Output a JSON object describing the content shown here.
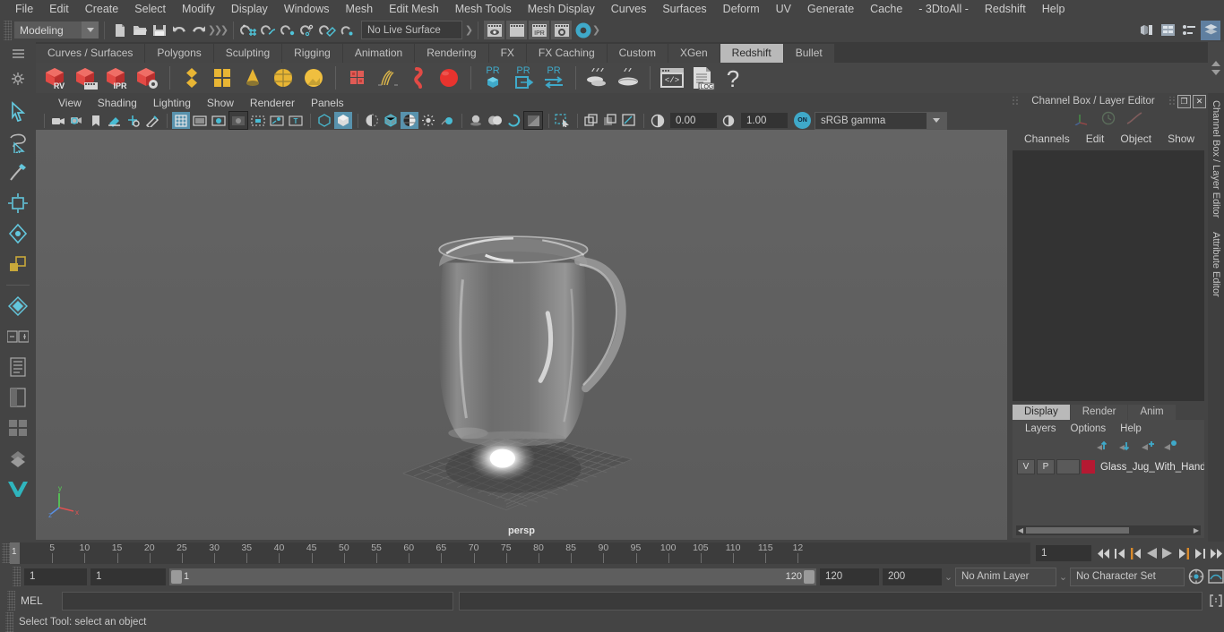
{
  "menubar": {
    "items": [
      "File",
      "Edit",
      "Create",
      "Select",
      "Modify",
      "Display",
      "Windows",
      "Mesh",
      "Edit Mesh",
      "Mesh Tools",
      "Mesh Display",
      "Curves",
      "Surfaces",
      "Deform",
      "UV",
      "Generate",
      "Cache",
      "- 3DtoAll -",
      "Redshift",
      "Help"
    ]
  },
  "statusline": {
    "mode": "Modeling",
    "live_surface": "No Live Surface",
    "render_buttons": [
      "render-view-icon",
      "render-sequence-icon",
      "ipr-icon",
      "render-settings-icon"
    ],
    "file_icons": [
      "new-scene-icon",
      "open-scene-icon",
      "save-scene-icon",
      "undo-icon",
      "redo-icon"
    ],
    "selection_mask_icons": [
      "select-by-hierarchy-icon",
      "select-by-object-icon",
      "select-by-component-icon"
    ],
    "snap_icons": [
      "snap-to-grid-icon",
      "snap-to-curve-icon",
      "snap-to-point-icon",
      "snap-to-projected-center-icon",
      "snap-to-view-plane-icon",
      "make-live-icon"
    ],
    "panel_toggle_icons": [
      "show-hide-modeling-toolkit-icon",
      "show-hide-attribute-editor-icon",
      "show-hide-tool-settings-icon",
      "show-hide-channel-box-icon"
    ]
  },
  "shelf": {
    "tabs": [
      "Curves / Surfaces",
      "Polygons",
      "Sculpting",
      "Rigging",
      "Animation",
      "Rendering",
      "FX",
      "FX Caching",
      "Custom",
      "XGen",
      "Redshift",
      "Bullet"
    ],
    "active_tab": "Redshift",
    "items": [
      {
        "name": "redshift-render-view-icon",
        "label": "RV"
      },
      {
        "name": "redshift-render-sequence-icon",
        "label": ""
      },
      {
        "name": "redshift-ipr-icon",
        "label": "IPR"
      },
      {
        "name": "redshift-render-settings-icon",
        "label": ""
      },
      {
        "name": "redshift-light-area-icon",
        "label": ""
      },
      {
        "name": "redshift-light-dome-icon",
        "label": ""
      },
      {
        "name": "redshift-light-ies-icon",
        "label": ""
      },
      {
        "name": "redshift-light-portal-icon",
        "label": ""
      },
      {
        "name": "redshift-environment-icon",
        "label": ""
      },
      {
        "name": "redshift-proxy-icon",
        "label": ""
      },
      {
        "name": "redshift-hair-icon",
        "label": ""
      },
      {
        "name": "redshift-volume-icon",
        "label": ""
      },
      {
        "name": "redshift-sphere-icon",
        "label": ""
      },
      {
        "name": "redshift-pr-object-icon",
        "label": "PR"
      },
      {
        "name": "redshift-pr-export-icon",
        "label": "PR"
      },
      {
        "name": "redshift-pr-transfer-icon",
        "label": "PR"
      },
      {
        "name": "redshift-bake-icon",
        "label": ""
      },
      {
        "name": "redshift-bake-set-icon",
        "label": ""
      },
      {
        "name": "redshift-script-editor-icon",
        "label": ""
      },
      {
        "name": "redshift-log-icon",
        "label": ".LOG"
      },
      {
        "name": "redshift-help-icon",
        "label": "?"
      }
    ]
  },
  "toolbox": {
    "items": [
      "select-tool-icon",
      "lasso-select-tool-icon",
      "paint-select-tool-icon",
      "move-tool-icon",
      "rotate-tool-icon",
      "scale-tool-icon",
      "last-tool-icon",
      "snap-grid-icon",
      "outliner-quick-layout-icon",
      "persp-layout-icon",
      "four-view-layout-icon",
      "hypergraph-layout-icon",
      "maya-logo-icon"
    ]
  },
  "viewport": {
    "menus": [
      "View",
      "Shading",
      "Lighting",
      "Show",
      "Renderer",
      "Panels"
    ],
    "camera_label": "persp",
    "exposure": "0.00",
    "gamma": "1.00",
    "color_toggle": "ON",
    "color_profile": "sRGB gamma",
    "toolbar_icons": [
      "select-camera-icon",
      "camera-attributes-icon",
      "bookmark-icon",
      "image-plane-icon",
      "two-d-pan-zoom-icon",
      "grease-pencil-icon",
      "grid-toggle-icon",
      "film-gate-icon",
      "resolution-gate-icon",
      "gate-mask-icon",
      "film-origin-icon",
      "light-manip-icon",
      "texture-placement-icon",
      "xray-icon",
      "xray-joints-icon",
      "wireframe-on-shaded-icon",
      "default-light-icon",
      "flat-shade-icon",
      "smooth-shade-icon",
      "shadows-icon",
      "ao-icon",
      "motion-blur-icon",
      "isolate-select-icon",
      "paint-effects-icon",
      "single-perspective-icon",
      "two-pane-icon",
      "multi-view-icon",
      "exposure-icon"
    ]
  },
  "channelbox": {
    "title": "Channel Box / Layer Editor",
    "menus": [
      "Channels",
      "Edit",
      "Object",
      "Show"
    ],
    "header_icons": [
      "axis-gizmo-icon",
      "clock-icon",
      "graph-icon"
    ],
    "window_buttons": [
      "restore-icon",
      "close-icon"
    ],
    "side_tabs": [
      "Channel Box / Layer Editor",
      "Attribute Editor"
    ]
  },
  "layereditor": {
    "tabs": [
      "Display",
      "Render",
      "Anim"
    ],
    "active_tab": "Display",
    "menus": [
      "Layers",
      "Options",
      "Help"
    ],
    "action_icons": [
      "move-layer-up-icon",
      "move-layer-down-icon",
      "new-layer-icon",
      "new-layer-from-selected-icon"
    ],
    "layers": [
      {
        "visibility": "V",
        "playback": "P",
        "shading": "",
        "color": "#b51932",
        "name": "Glass_Jug_With_Hand"
      }
    ]
  },
  "timeslider": {
    "current_frame": "1",
    "tick_labels": [
      "5",
      "10",
      "15",
      "20",
      "25",
      "30",
      "35",
      "40",
      "45",
      "50",
      "55",
      "60",
      "65",
      "70",
      "75",
      "80",
      "85",
      "90",
      "95",
      "100",
      "105",
      "110",
      "115",
      "12"
    ],
    "playback_icons": [
      "go-to-start-icon",
      "step-back-keyframe-icon",
      "step-back-frame-icon",
      "play-backwards-icon",
      "play-forwards-icon",
      "step-forward-frame-icon",
      "step-forward-keyframe-icon",
      "go-to-end-icon"
    ]
  },
  "rangeslider": {
    "anim_start": "1",
    "range_start": "1",
    "bar_start_label": "1",
    "bar_end_label": "120",
    "range_end": "120",
    "anim_end": "200",
    "anim_layer": "No Anim Layer",
    "character_set": "No Character Set",
    "right_icons": [
      "auto-keyframe-icon",
      "animation-preferences-icon"
    ]
  },
  "command": {
    "label": "MEL",
    "input_value": "",
    "output_value": "",
    "script_editor_icon": "script-editor-icon"
  },
  "statusbar": {
    "help_text": "Select Tool: select an object"
  },
  "colors": {
    "accent_teal": "#3fa9c9",
    "accent_blue": "#5892ad",
    "accent_orange": "#d98a2b",
    "redshift_red": "#d33a3a",
    "shelf_yellow": "#e8b534",
    "layer_red": "#b51932"
  }
}
